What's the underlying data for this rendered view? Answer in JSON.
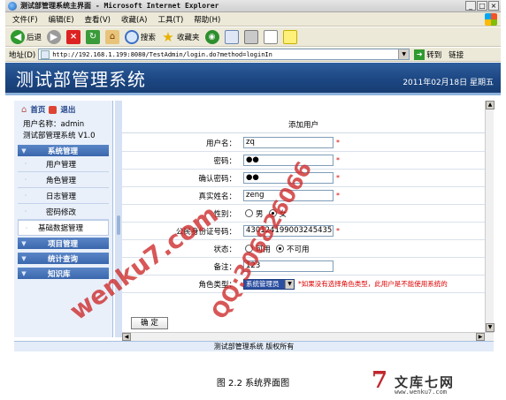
{
  "window": {
    "title": "测试部管理系统主界面 - Microsoft Internet Explorer",
    "buttons": [
      "_",
      "□",
      "×"
    ]
  },
  "menu": [
    "文件(F)",
    "编辑(E)",
    "查看(V)",
    "收藏(A)",
    "工具(T)",
    "帮助(H)"
  ],
  "toolbar": {
    "back_label": "后退",
    "search_label": "搜索",
    "favorites_label": "收藏夹"
  },
  "address": {
    "label": "地址(D)",
    "url": "http://192.168.1.199:8080/TestAdmin/login.do?method=loginIn",
    "go_label": "转到",
    "links_label": "链接"
  },
  "banner": {
    "title": "测试部管理系统",
    "date": "2011年02月18日  星期五"
  },
  "sidebar": {
    "home": "首页",
    "logout": "退出",
    "user_line": "用户名称：admin",
    "system_line": "测试部管理系统 V1.0",
    "sections": [
      {
        "label": "系统管理",
        "items": [
          "用户管理",
          "角色管理",
          "日志管理",
          "密码修改",
          "基础数据管理"
        ]
      },
      {
        "label": "项目管理",
        "items": []
      },
      {
        "label": "统计查询",
        "items": []
      },
      {
        "label": "知识库",
        "items": []
      }
    ]
  },
  "form": {
    "heading": "添加用户",
    "fields": [
      {
        "label": "用户名：",
        "value": "zq",
        "required": "*"
      },
      {
        "label": "密码：",
        "value": "●●",
        "required": "*"
      },
      {
        "label": "确认密码：",
        "value": "●●",
        "required": "*"
      },
      {
        "label": "真实姓名：",
        "value": "zeng",
        "required": "*"
      }
    ],
    "gender": {
      "label": "性别：",
      "options": [
        "男",
        "女"
      ],
      "selected": "女"
    },
    "id_card": {
      "label": "公民身份证号码：",
      "value": "430124199003245435",
      "required": "*"
    },
    "status": {
      "label": "状态：",
      "options": [
        "可用",
        "不可用"
      ],
      "selected": "不可用"
    },
    "note": {
      "label": "备注：",
      "value": "123"
    },
    "role": {
      "label": "角色类型：",
      "selected": "系统管理员",
      "warning": "*如果没有选择角色类型，此用户是不能使用系统的"
    },
    "ok_button": "确  定"
  },
  "footer": "测试部管理系统  版权所有",
  "caption": "图 2.2  系统界面图",
  "watermarks": [
    "wenku7.com",
    "QQ:306826066"
  ],
  "logo": {
    "name": "文库七网",
    "url": "www.wenku7.com",
    "mark": "7"
  }
}
